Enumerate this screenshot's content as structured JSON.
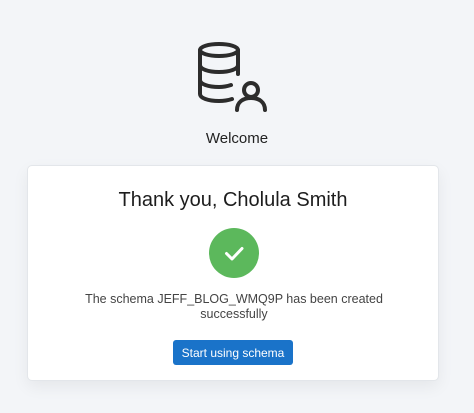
{
  "app": {
    "welcome": "Welcome"
  },
  "card": {
    "title": "Thank you, Cholula Smith",
    "message": "The schema JEFF_BLOG_WMQ9P has been created successfully",
    "button_label": "Start using schema"
  },
  "icons": {
    "logo": "database-user-icon",
    "status": "checkmark-icon"
  },
  "colors": {
    "background": "#f3f5f8",
    "success": "#5cb85c",
    "primary_button": "#1a73c9"
  }
}
